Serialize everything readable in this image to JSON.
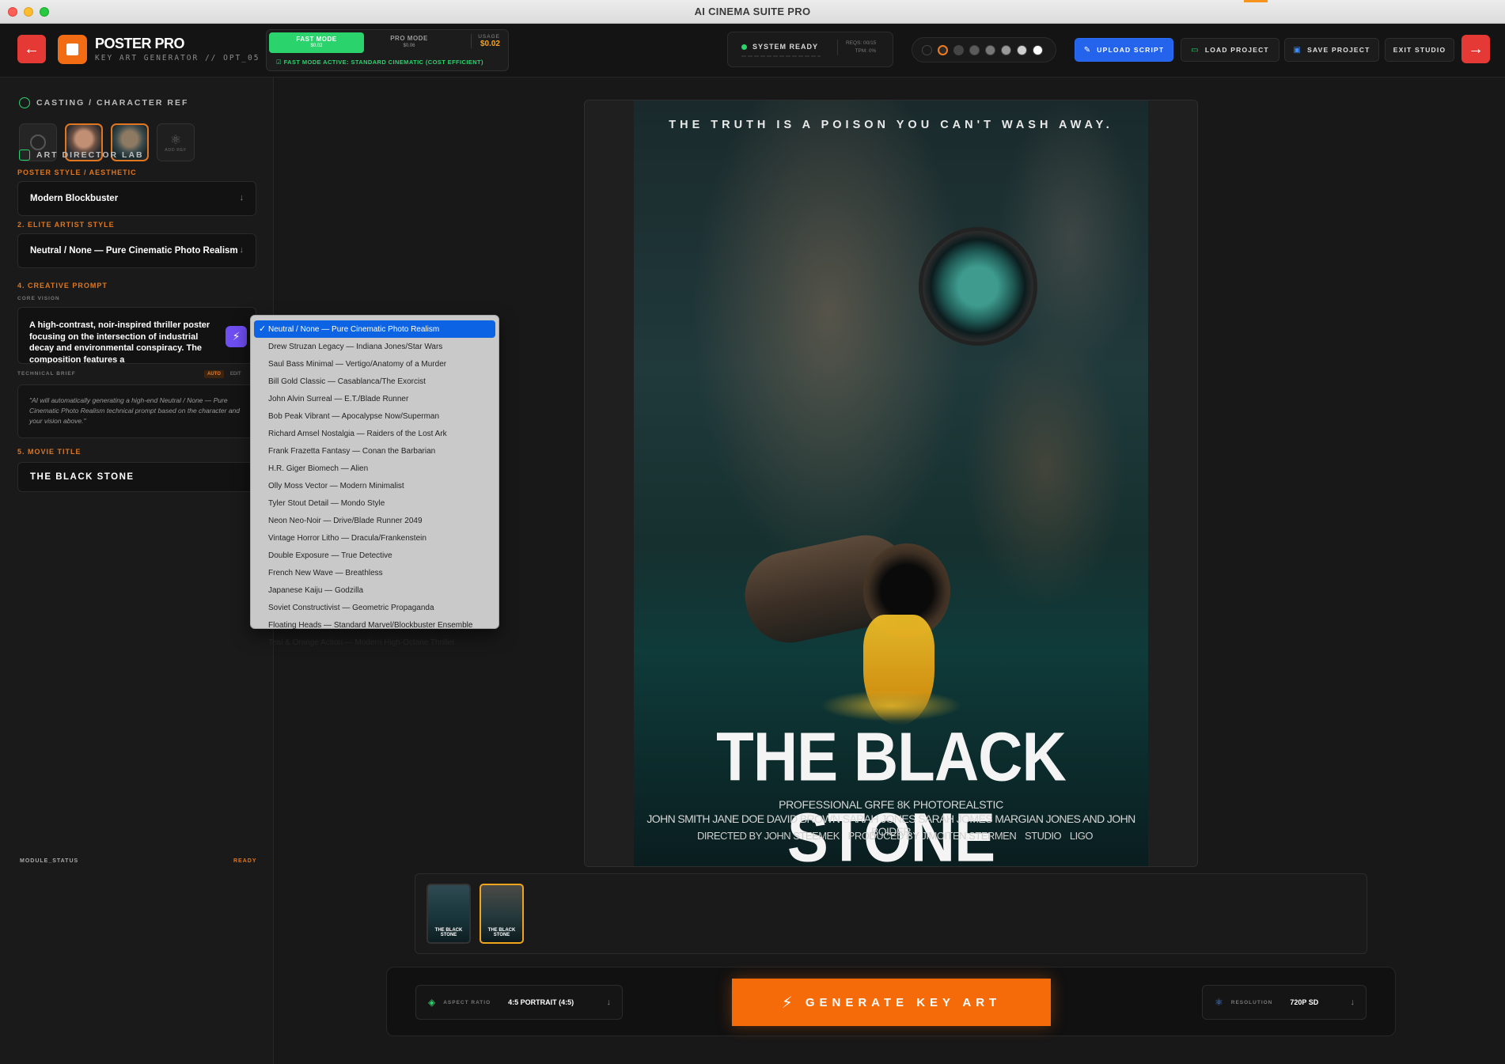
{
  "window": {
    "title": "AI CINEMA SUITE PRO"
  },
  "header": {
    "app_title": "POSTER PRO",
    "app_subtitle": "KEY ART GENERATOR // OPT_05",
    "modes": {
      "fast_label": "FAST MODE",
      "fast_price": "$0.02",
      "pro_label": "PRO MODE",
      "pro_price": "$0.06",
      "usage_label": "USAGE",
      "usage_value": "$0.02",
      "active_message": "FAST MODE ACTIVE: STANDARD CINEMATIC (COST EFFICIENT)"
    },
    "system": {
      "status": "SYSTEM READY",
      "reqs": "REQS: 00/15",
      "tpm": "TPM: 0%"
    },
    "buttons": {
      "upload": "UPLOAD SCRIPT",
      "load": "LOAD PROJECT",
      "save": "SAVE PROJECT",
      "exit": "EXIT STUDIO"
    },
    "swatches": [
      "#1a1a1a",
      "#2b2b2b",
      "#444444",
      "#5b5b5b",
      "#777777",
      "#999999",
      "#cfcfcf",
      "#ffffff"
    ]
  },
  "sidebar": {
    "casting_header": "CASTING / CHARACTER REF",
    "add_ref": "ADD REF",
    "art_lab_header": "ART DIRECTOR LAB",
    "poster_style_label": "POSTER STYLE / AESTHETIC",
    "poster_style_value": "Modern Blockbuster",
    "artist_style_label": "2. ELITE ARTIST STYLE",
    "artist_style_value": "Neutral / None — Pure Cinematic Photo Realism",
    "creative_prompt_label": "4. CREATIVE PROMPT",
    "core_vision_label": "CORE VISION",
    "core_vision_text": "A high-contrast, noir-inspired thriller poster focusing on the intersection of industrial decay and environmental conspiracy. The composition features a",
    "technical_brief_label": "TECHNICAL BRIEF",
    "tag_auto": "AUTO",
    "tag_edit": "EDIT",
    "technical_brief_text": "\"AI will automatically generating a high-end Neutral / None — Pure Cinematic Photo Realism technical prompt based on the character and your vision above.\"",
    "movie_title_label": "5. MOVIE TITLE",
    "movie_title_value": "THE BLACK STONE",
    "module_status": "MODULE_STATUS",
    "module_state": "READY"
  },
  "dropdown": {
    "selected_index": 0,
    "options": [
      "Neutral / None — Pure Cinematic Photo Realism",
      "Drew Struzan Legacy — Indiana Jones/Star Wars",
      "Saul Bass Minimal — Vertigo/Anatomy of a Murder",
      "Bill Gold Classic — Casablanca/The Exorcist",
      "John Alvin Surreal — E.T./Blade Runner",
      "Bob Peak Vibrant — Apocalypse Now/Superman",
      "Richard Amsel Nostalgia — Raiders of the Lost Ark",
      "Frank Frazetta Fantasy — Conan the Barbarian",
      "H.R. Giger Biomech — Alien",
      "Olly Moss Vector — Modern Minimalist",
      "Tyler Stout Detail — Mondo Style",
      "Neon Neo-Noir — Drive/Blade Runner 2049",
      "Vintage Horror Litho — Dracula/Frankenstein",
      "Double Exposure — True Detective",
      "French New Wave — Breathless",
      "Japanese Kaiju — Godzilla",
      "Soviet Constructivist — Geometric Propaganda",
      "Floating Heads — Standard Marvel/Blockbuster Ensemble",
      "Teal & Orange Action — Modern High-Octane Thriller"
    ]
  },
  "poster": {
    "tagline": "THE TRUTH IS A POISON YOU CAN'T WASH AWAY.",
    "title": "THE BLACK STONE",
    "credits_line1": "PROFESSIONAL GRFE 8K PHOTOREALSTIC",
    "credits_line2": "JOHN SMITH  JANE DOE  DAVID BROWN  SARAH JONES  SARAH JOMES  MARGIAN JONES AND JOHN BOIDER",
    "credits_director": "DIRECTED BY JOHN STEEMEK",
    "credits_producer": "PRODUCED BY JIMOITEN STERMEN",
    "credits_studio": "STUDIO",
    "credits_logo": "LIGO"
  },
  "thumbnails": [
    {
      "label": "THE BLACK STONE"
    },
    {
      "label": "THE BLACK STONE"
    }
  ],
  "controls": {
    "aspect_label": "ASPECT RATIO",
    "aspect_value": "4:5 PORTRAIT (4:5)",
    "generate_label": "GENERATE KEY ART",
    "resolution_label": "RESOLUTION",
    "resolution_value": "720P SD"
  }
}
